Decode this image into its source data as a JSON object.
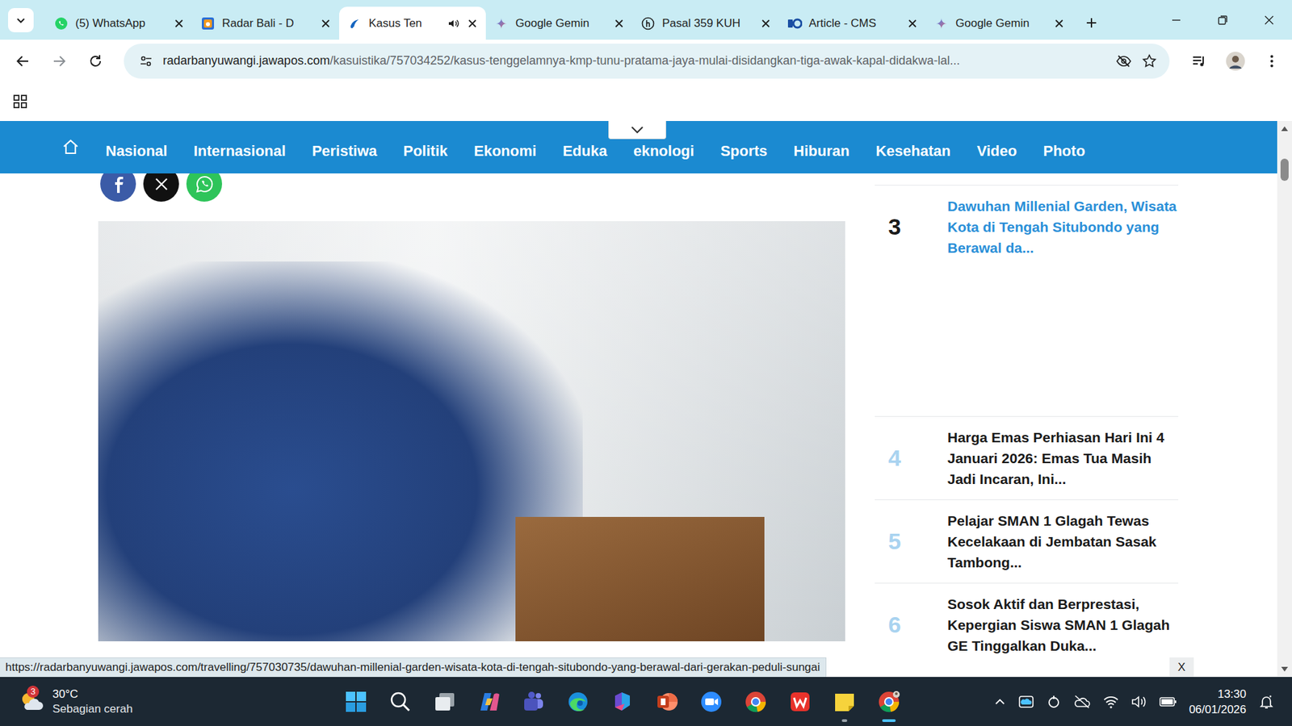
{
  "browser": {
    "tabs": [
      {
        "label": "(5) WhatsApp",
        "kind": "whatsapp",
        "selected": false,
        "audio": false
      },
      {
        "label": "Radar Bali - D",
        "kind": "radar",
        "selected": false,
        "audio": false
      },
      {
        "label": "Kasus Ten",
        "kind": "jawapos",
        "selected": true,
        "audio": true
      },
      {
        "label": "Google Gemin",
        "kind": "gemini",
        "selected": false,
        "audio": false
      },
      {
        "label": "Pasal 359 KUH",
        "kind": "hukum",
        "selected": false,
        "audio": false
      },
      {
        "label": "Article - CMS",
        "kind": "cms",
        "selected": false,
        "audio": false
      },
      {
        "label": "Google Gemin",
        "kind": "gemini",
        "selected": false,
        "audio": false
      }
    ],
    "address": {
      "domain": "radarbanyuwangi.jawapos.com",
      "path": "/kasuistika/757034252/kasus-tenggelamnya-kmp-tunu-pratama-jaya-mulai-disidangkan-tiga-awak-kapal-didakwa-lal..."
    }
  },
  "page": {
    "nav": [
      "Nasional",
      "Internasional",
      "Peristiwa",
      "Politik",
      "Ekonomi",
      "Eduka",
      "eknologi",
      "Sports",
      "Hiburan",
      "Kesehatan",
      "Video",
      "Photo"
    ],
    "popular": [
      {
        "rank": "3",
        "title": "Dawuhan Millenial Garden, Wisata Kota di Tengah Situbondo yang Berawal da...",
        "hovered": true
      },
      {
        "rank": "4",
        "title": "Harga Emas Perhiasan Hari Ini 4 Januari 2026: Emas Tua Masih Jadi Incaran, Ini...",
        "hovered": false
      },
      {
        "rank": "5",
        "title": "Pelajar SMAN 1 Glagah Tewas Kecelakaan di Jembatan Sasak Tambong...",
        "hovered": false
      },
      {
        "rank": "6",
        "title": "Sosok Aktif dan Berprestasi, Kepergian Siswa SMAN 1 Glagah GE Tinggalkan Duka...",
        "hovered": false
      }
    ]
  },
  "status_url": "https://radarbanyuwangi.jawapos.com/travelling/757030735/dawuhan-millenial-garden-wisata-kota-di-tengah-situbondo-yang-berawal-dari-gerakan-peduli-sungai",
  "ad_close": "X",
  "taskbar": {
    "weather": {
      "temp": "30°C",
      "desc": "Sebagian cerah",
      "badge": "3"
    },
    "apps": [
      {
        "kind": "start",
        "running": false,
        "active": false
      },
      {
        "kind": "search",
        "running": false,
        "active": false
      },
      {
        "kind": "taskview",
        "running": false,
        "active": false
      },
      {
        "kind": "copilot",
        "running": false,
        "active": false
      },
      {
        "kind": "teams",
        "running": false,
        "active": false
      },
      {
        "kind": "edge",
        "running": false,
        "active": false
      },
      {
        "kind": "m365",
        "running": false,
        "active": false
      },
      {
        "kind": "powerpoint",
        "running": false,
        "active": false
      },
      {
        "kind": "zoom",
        "running": false,
        "active": false
      },
      {
        "kind": "chrome",
        "running": false,
        "active": false
      },
      {
        "kind": "wps",
        "running": false,
        "active": false
      },
      {
        "kind": "notes",
        "running": true,
        "active": false
      },
      {
        "kind": "chromeprofile",
        "running": true,
        "active": true
      }
    ],
    "clock": {
      "time": "13:30",
      "date": "06/01/2026"
    }
  }
}
